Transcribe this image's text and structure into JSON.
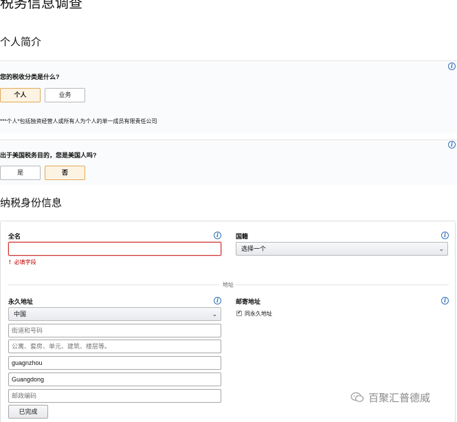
{
  "page": {
    "title": "税务信息调查"
  },
  "sections": {
    "profile": "个人简介",
    "tax_identity": "纳税身份信息"
  },
  "q1": {
    "question": "您的税收分类是什么?",
    "options": [
      "个人",
      "业务"
    ],
    "selected": "个人",
    "note": "***个人*包括独资经营人或所有人为个人的单一成员有限责任公司"
  },
  "q2": {
    "question": "出于美国税务目的，您是美国人吗?",
    "options": [
      "是",
      "否"
    ],
    "selected": "否"
  },
  "form": {
    "full_name_label": "全名",
    "full_name_value": "",
    "required_msg": "必填字段",
    "nationality_label": "国籍",
    "nationality_value": "选择一个",
    "address_divider": "地址",
    "permanent_address_label": "永久地址",
    "country_value": "中国",
    "street_placeholder": "街道和号码",
    "unit_placeholder": "公寓、套房、单元、建筑、楼层等。",
    "city_value": "guagnzhou",
    "province_value": "Guangdong",
    "postal_placeholder": "邮政编码",
    "mailing_address_label": "邮寄地址",
    "same_as_permanent": "同永久地址",
    "same_as_permanent_checked": true,
    "done_label": "已完成"
  },
  "watermark": {
    "text": "百聚汇普德威"
  },
  "colors": {
    "accent": "#e3a857",
    "error": "#d0312d",
    "info": "#2f6fb5"
  }
}
